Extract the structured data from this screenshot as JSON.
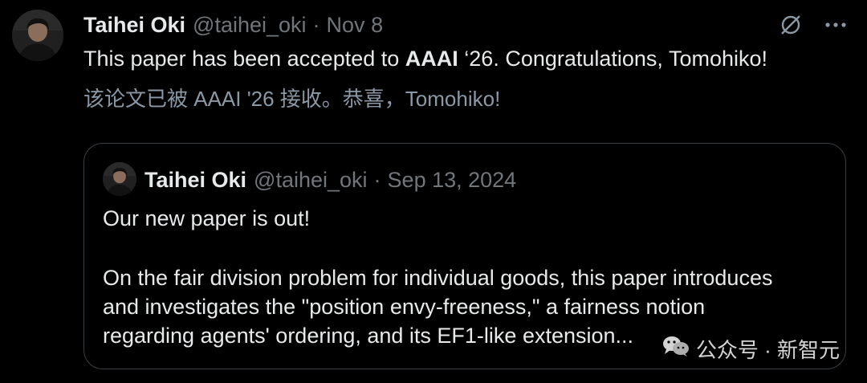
{
  "tweet": {
    "author_name": "Taihei Oki",
    "handle": "@taihei_oki",
    "separator": "·",
    "date": "Nov 8",
    "text_before": "This paper has been accepted to ",
    "text_bold": "AAAI",
    "text_after": " ‘26. Congratulations, Tomohiko!",
    "translation": "该论文已被 AAAI '26 接收。恭喜，Tomohiko!",
    "icons": [
      "grok-icon",
      "more-icon"
    ]
  },
  "quoted": {
    "author_name": "Taihei Oki",
    "handle": "@taihei_oki",
    "separator": "·",
    "date": "Sep 13, 2024",
    "line1": "Our new paper is out!",
    "line2": "On the fair division problem for individual goods, this paper introduces",
    "line3": "and investigates the \"position envy-freeness,\" a fairness notion",
    "line4": "regarding agents' ordering, and its EF1-like extension..."
  },
  "watermark": {
    "text": "公众号 · 新智元",
    "icon": "wechat-icon"
  },
  "colors": {
    "background": "#000000",
    "primary_text": "#e7e9ea",
    "secondary_text": "#71767b",
    "border": "#3a3f44"
  }
}
